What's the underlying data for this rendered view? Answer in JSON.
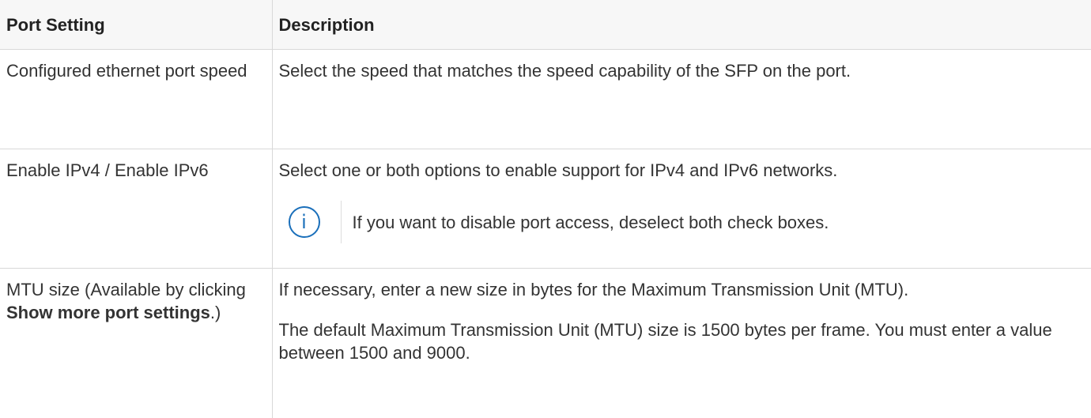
{
  "table": {
    "headers": [
      "Port Setting",
      "Description"
    ],
    "rows": [
      {
        "setting": "Configured ethernet port speed",
        "description": "Select the speed that matches the speed capability of the SFP on the port."
      },
      {
        "setting": "Enable IPv4 / Enable IPv6",
        "description": "Select one or both options to enable support for IPv4 and IPv6 networks.",
        "note": "If you want to disable port access, deselect both check boxes.",
        "note_icon": "info-icon"
      },
      {
        "setting_prefix": "MTU size (Available by clicking ",
        "setting_bold": "Show more port settings",
        "setting_suffix": ".)",
        "description": "If necessary, enter a new size in bytes for the Maximum Transmission Unit (MTU).",
        "description_2": "The default Maximum Transmission Unit (MTU) size is 1500 bytes per frame. You must enter a value between 1500 and 9000."
      }
    ]
  },
  "colors": {
    "note_icon": "#1a6fba",
    "border": "#d8d8d8",
    "header_bg": "#f7f7f7"
  }
}
